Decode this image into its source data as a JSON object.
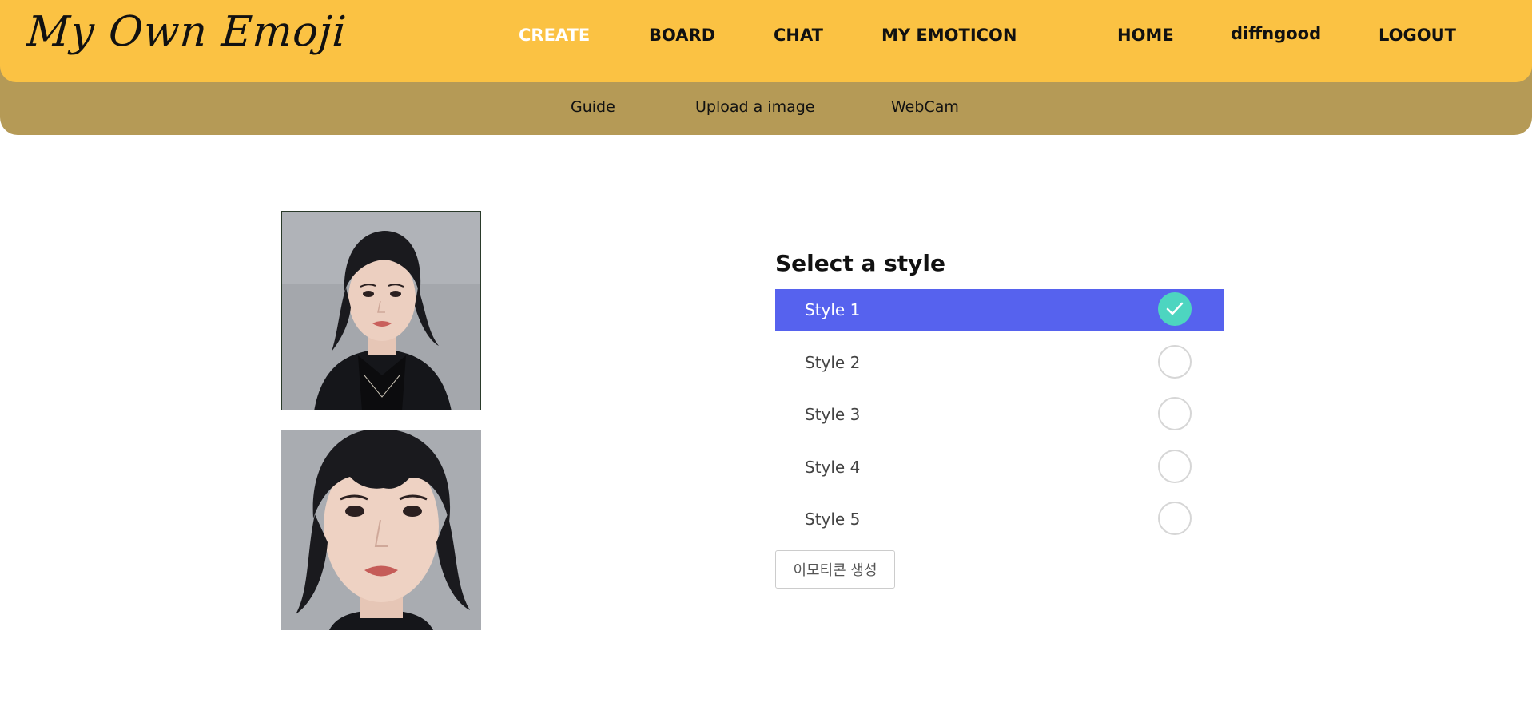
{
  "header": {
    "logo": "My Own Emoji",
    "nav": [
      {
        "label": "CREATE",
        "active": true
      },
      {
        "label": "BOARD",
        "active": false
      },
      {
        "label": "CHAT",
        "active": false
      },
      {
        "label": "MY EMOTICON",
        "active": false
      }
    ],
    "right_nav": {
      "home": "HOME",
      "username": "diffngood",
      "logout": "LOGOUT"
    },
    "colors": {
      "bar": "#fbc243",
      "subbar": "#b59a56",
      "active_text": "#ffffff"
    }
  },
  "subnav": {
    "items": [
      "Guide",
      "Upload a image",
      "WebCam"
    ]
  },
  "photos": [
    {
      "name": "uploaded-photo"
    },
    {
      "name": "aligned-face-photo"
    }
  ],
  "style_selector": {
    "title": "Select a style",
    "selected_index": 0,
    "options": [
      "Style 1",
      "Style 2",
      "Style 3",
      "Style 4",
      "Style 5"
    ],
    "colors": {
      "selected_row": "#5662ee",
      "checked_radio": "#4dd5c0"
    },
    "check_icon": "check-icon"
  },
  "generate_button": {
    "label": "이모티콘 생성"
  }
}
